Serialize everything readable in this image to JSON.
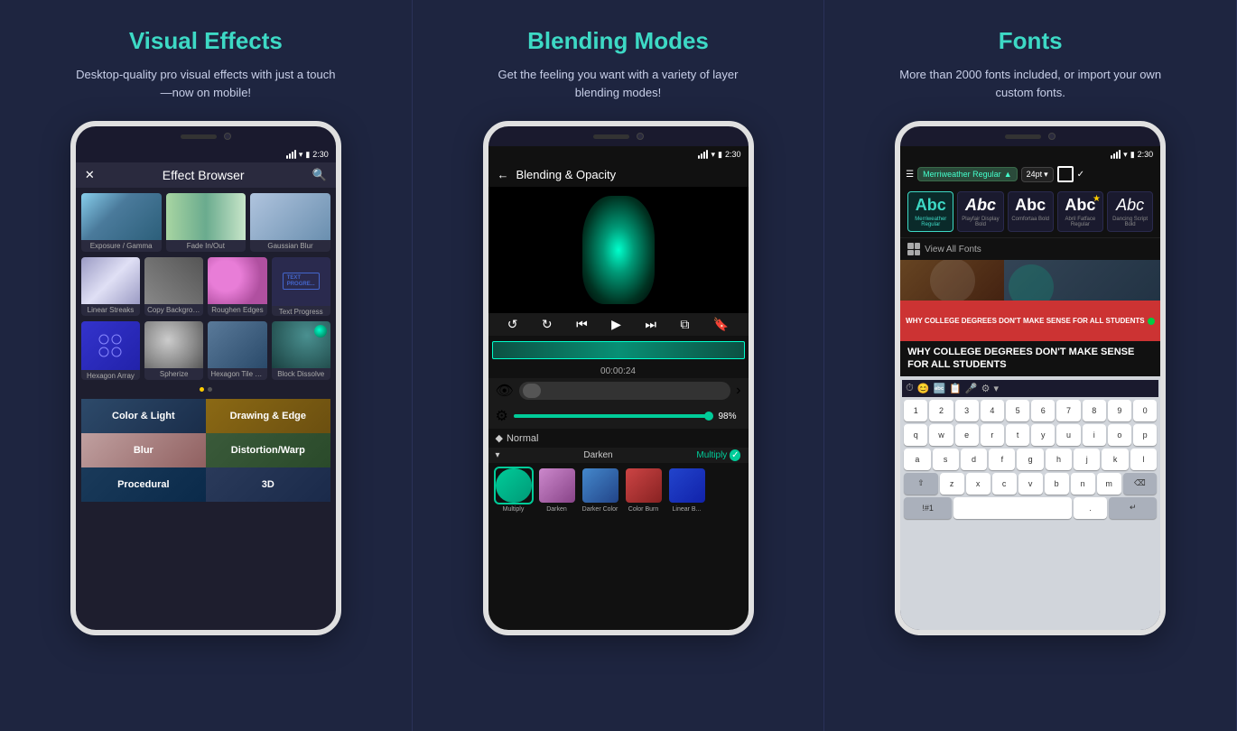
{
  "panels": [
    {
      "id": "visual-effects",
      "title": "Visual Effects",
      "subtitle": "Desktop-quality pro visual effects with just a touch—now on mobile!",
      "screen": {
        "status_time": "2:30",
        "toolbar_title": "Effect Browser",
        "effects_row1": [
          {
            "name": "Exposure / Gamma",
            "thumb": "exposure"
          },
          {
            "name": "Fade In/Out",
            "thumb": "fade"
          },
          {
            "name": "Gaussian Blur",
            "thumb": "gaussian"
          }
        ],
        "effects_row2": [
          {
            "name": "Linear Streaks",
            "thumb": "linear"
          },
          {
            "name": "Copy Background",
            "thumb": "copy"
          },
          {
            "name": "Roughen Edges",
            "thumb": "roughen"
          },
          {
            "name": "Text Progress",
            "thumb": "text"
          }
        ],
        "effects_row3": [
          {
            "name": "Hexagon Array",
            "thumb": "hexarray"
          },
          {
            "name": "Spherize",
            "thumb": "spherize"
          },
          {
            "name": "Hexagon Tile Shift",
            "thumb": "hexshift"
          },
          {
            "name": "Block Dissolve",
            "thumb": "dissolve"
          }
        ],
        "categories": [
          {
            "name": "Color & Light",
            "color": "light"
          },
          {
            "name": "Drawing & Edge",
            "color": "drawing"
          },
          {
            "name": "Blur",
            "color": "blur"
          },
          {
            "name": "Distortion/Warp",
            "color": "distort"
          },
          {
            "name": "Procedural",
            "color": "procedural"
          },
          {
            "name": "3D",
            "color": "3d"
          }
        ]
      }
    },
    {
      "id": "blending-modes",
      "title": "Blending Modes",
      "subtitle": "Get the feeling you want with a variety of layer blending modes!",
      "screen": {
        "status_time": "2:30",
        "toolbar_title": "Blending & Opacity",
        "timecode": "00:00:24",
        "opacity_percent": "98%",
        "blend_mode": "Normal",
        "darken_label": "Darken",
        "multiply_label": "Multiply",
        "blend_items": [
          {
            "name": "Multiply",
            "active": true
          },
          {
            "name": "Darken"
          },
          {
            "name": "Darker Color"
          },
          {
            "name": "Color Burn"
          },
          {
            "name": "Linear B..."
          }
        ]
      }
    },
    {
      "id": "fonts",
      "title": "Fonts",
      "subtitle": "More than 2000 fonts included, or import your own custom fonts.",
      "screen": {
        "status_time": "2:30",
        "font_selected": "Merriweather Regular",
        "font_size": "24pt",
        "view_all_label": "View All Fonts",
        "fonts": [
          {
            "name": "Merriweather Regular",
            "active": true,
            "starred": false
          },
          {
            "name": "Playfair Display Bold",
            "active": false,
            "starred": false
          },
          {
            "name": "Comfortaa Bold",
            "active": false,
            "starred": false
          },
          {
            "name": "Abril Fatface Regular",
            "active": false,
            "starred": true
          },
          {
            "name": "Dancing Script Bold",
            "active": false,
            "starred": false
          }
        ],
        "headline_text": "WHY COLLEGE DEGREES DON'T MAKE SENSE FOR ALL STUDENTS",
        "keyboard_rows": [
          [
            "1",
            "2",
            "3",
            "4",
            "5",
            "6",
            "7",
            "8",
            "9",
            "0"
          ],
          [
            "q",
            "w",
            "e",
            "r",
            "t",
            "y",
            "u",
            "i",
            "o",
            "p"
          ],
          [
            "a",
            "s",
            "d",
            "f",
            "g",
            "h",
            "j",
            "k",
            "l"
          ],
          [
            "⇧",
            "z",
            "x",
            "c",
            "v",
            "b",
            "n",
            "m",
            "⌫"
          ],
          [
            "!#1",
            "",
            "",
            "",
            "",
            "",
            "",
            "",
            "",
            ".",
            "↵"
          ]
        ]
      }
    }
  ]
}
